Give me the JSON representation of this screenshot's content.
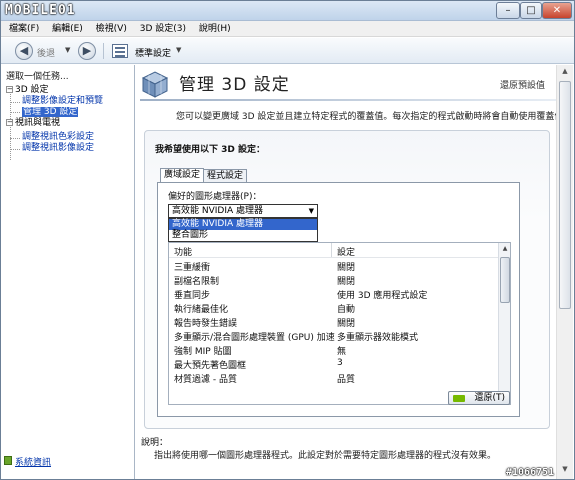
{
  "title_logo": "MOBILE01",
  "window_controls": {
    "minimize": "–",
    "maximize": "□",
    "close": "✕"
  },
  "menu": [
    "檔案(F)",
    "編輯(E)",
    "檢視(V)",
    "3D 設定(3)",
    "說明(H)"
  ],
  "toolbar": {
    "back_label": "後退",
    "view_label": "標準設定"
  },
  "left_panel": {
    "heading": "選取一個任務...",
    "tree": [
      {
        "label": "3D 設定",
        "type": "category"
      },
      {
        "label": "調整影像設定和預覽",
        "type": "link"
      },
      {
        "label": "管理 3D 設定",
        "type": "selected"
      },
      {
        "label": "視訊與電視",
        "type": "category"
      },
      {
        "label": "調整視訊色彩設定",
        "type": "link"
      },
      {
        "label": "調整視訊影像設定",
        "type": "link"
      }
    ],
    "system_info": "系統資訊"
  },
  "main": {
    "title": "管理 3D 設定",
    "restore_defaults": "還原預設值",
    "intro": "您可以變更廣域 3D 設定並且建立特定程式的覆蓋值。每次指定的程式啟動時將會自動使用覆蓋值。",
    "group_label": "我希望使用以下 3D 設定：",
    "tabs": [
      "廣域設定",
      "程式設定"
    ],
    "gpu_label": "偏好的圖形處理器(P)：",
    "gpu_selected": "高效能 NVIDIA 處理器",
    "gpu_options": [
      "高效能 NVIDIA 處理器",
      "整合圖形"
    ],
    "table": {
      "headers": [
        "功能",
        "設定"
      ],
      "rows": [
        [
          "三重緩衝",
          "關閉"
        ],
        [
          "副檔名限制",
          "關閉"
        ],
        [
          "垂直同步",
          "使用 3D 應用程式設定"
        ],
        [
          "執行緒最佳化",
          "自動"
        ],
        [
          "報告時發生錯誤",
          "關閉"
        ],
        [
          "多重顯示/混合圖形處理裝置 (GPU) 加速",
          "多重顯示器效能模式"
        ],
        [
          "強制 MIP 貼圖",
          "無"
        ],
        [
          "最大預先著色圖框",
          "3"
        ],
        [
          "材質過濾 - 品質",
          "品質"
        ]
      ]
    },
    "restore_button": "還原(T)",
    "description_label": "說明：",
    "description_text": "指出將使用哪一個圖形處理器程式。此設定對於需要特定圖形處理器的程式沒有效果。"
  },
  "watermark": "#1066751"
}
